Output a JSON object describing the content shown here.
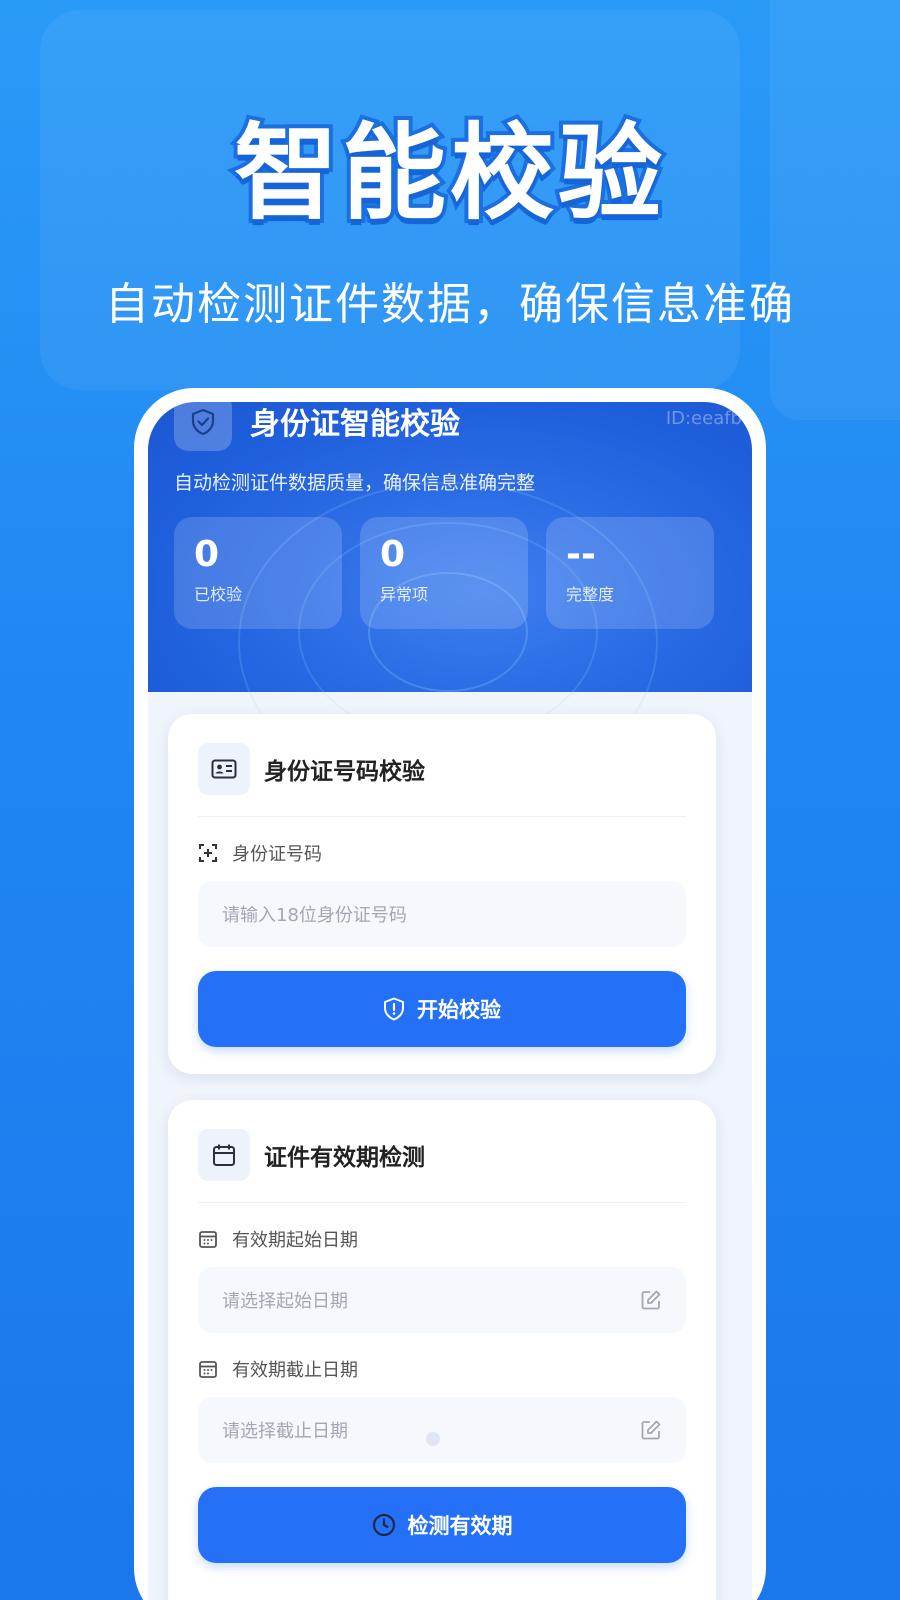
{
  "hero": {
    "title": "智能校验",
    "subtitle": "自动检测证件数据，确保信息准确"
  },
  "screen": {
    "header": {
      "title": "身份证智能校验",
      "id_text": "ID:eeafb",
      "description": "自动检测证件数据质量，确保信息准确完整",
      "stats": [
        {
          "value": "0",
          "label": "已校验"
        },
        {
          "value": "0",
          "label": "异常项"
        },
        {
          "value": "--",
          "label": "完整度"
        }
      ]
    },
    "id_card": {
      "title": "身份证号码校验",
      "field_label": "身份证号码",
      "placeholder": "请输入18位身份证号码",
      "button_label": "开始校验"
    },
    "validity": {
      "title": "证件有效期检测",
      "start_label": "有效期起始日期",
      "start_placeholder": "请选择起始日期",
      "end_label": "有效期截止日期",
      "end_placeholder": "请选择截止日期",
      "button_label": "检测有效期"
    }
  },
  "colors": {
    "background": "#1f86f2",
    "header": "#1f5fdc",
    "button": "#2470f6"
  },
  "icons": [
    "shield-icon",
    "id-card-icon",
    "scan-icon",
    "shield-alert-icon",
    "calendar-icon",
    "edit-icon",
    "clock-icon"
  ]
}
